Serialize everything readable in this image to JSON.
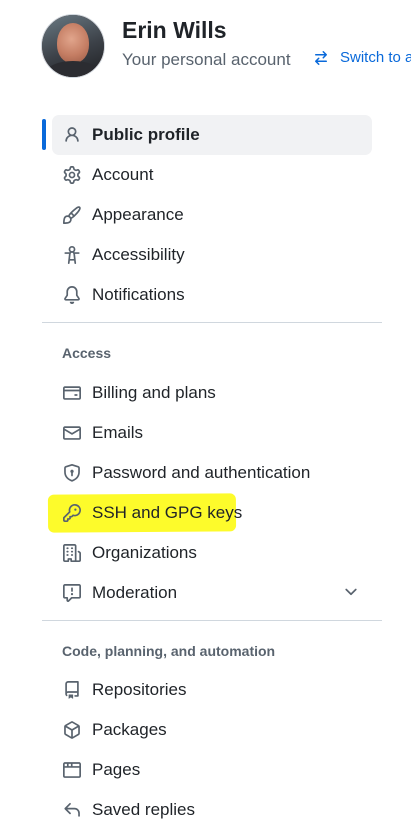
{
  "user": {
    "name": "Erin Wills",
    "subtitle": "Your personal account",
    "switch_label": "Switch to a"
  },
  "nav": {
    "top_items": [
      {
        "label": "Public profile",
        "icon": "person-icon",
        "active": true
      },
      {
        "label": "Account",
        "icon": "gear-icon"
      },
      {
        "label": "Appearance",
        "icon": "paintbrush-icon"
      },
      {
        "label": "Accessibility",
        "icon": "accessibility-icon"
      },
      {
        "label": "Notifications",
        "icon": "bell-icon"
      }
    ],
    "access_heading": "Access",
    "access_items": [
      {
        "label": "Billing and plans",
        "icon": "credit-card-icon"
      },
      {
        "label": "Emails",
        "icon": "mail-icon"
      },
      {
        "label": "Password and authentication",
        "icon": "shield-lock-icon"
      },
      {
        "label": "SSH and GPG keys",
        "icon": "key-icon",
        "highlighted": true
      },
      {
        "label": "Organizations",
        "icon": "organization-icon"
      },
      {
        "label": "Moderation",
        "icon": "report-icon",
        "expandable": true
      }
    ],
    "code_heading": "Code, planning, and automation",
    "code_items": [
      {
        "label": "Repositories",
        "icon": "repo-icon"
      },
      {
        "label": "Packages",
        "icon": "package-icon"
      },
      {
        "label": "Pages",
        "icon": "browser-icon"
      },
      {
        "label": "Saved replies",
        "icon": "reply-icon"
      }
    ]
  },
  "colors": {
    "accent": "#0969da",
    "highlight": "#fdfb2b",
    "muted": "#59636e",
    "active_bg": "#f1f2f4"
  }
}
